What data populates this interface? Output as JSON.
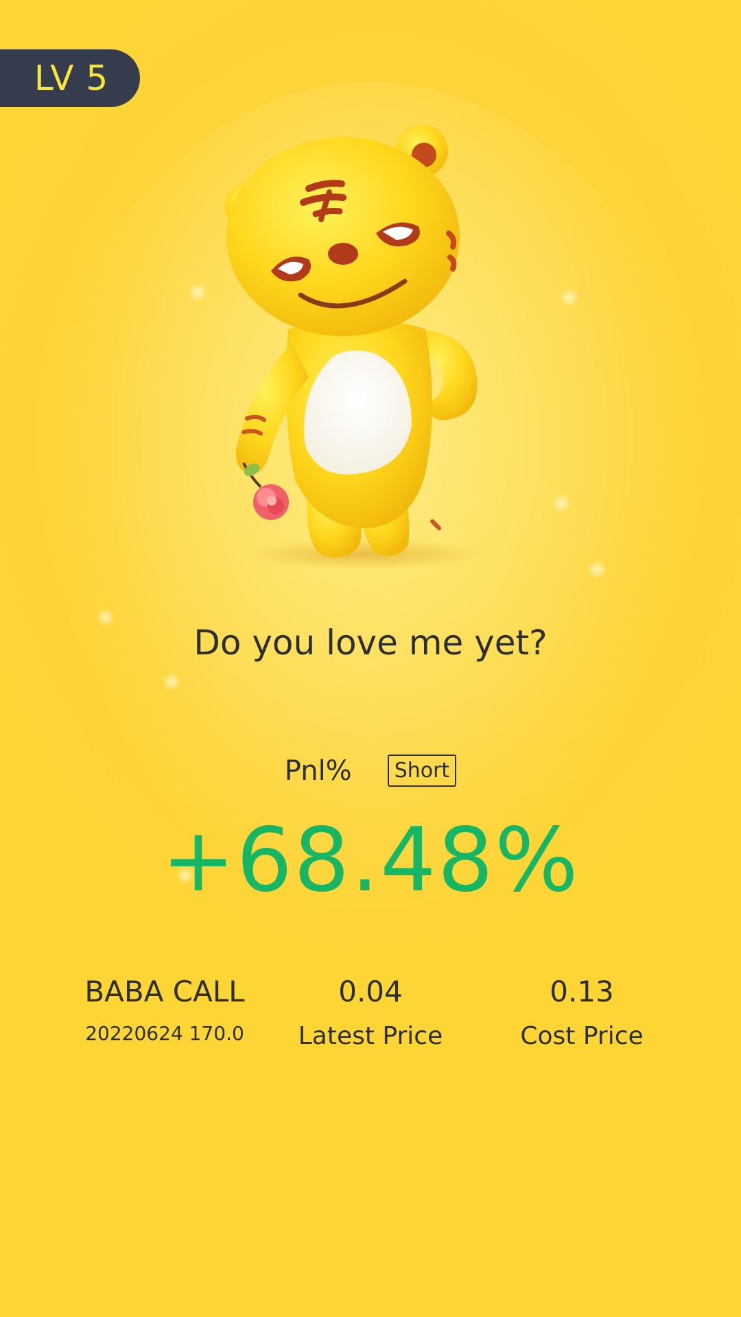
{
  "level_badge": {
    "label": "LV 5"
  },
  "mascot": {
    "icon": "tiger-mascot-icon",
    "holding": "flower-icon"
  },
  "tagline": "Do you love me yet?",
  "pnl": {
    "label": "Pnl%",
    "direction_tag": "Short",
    "value": "+68.48%",
    "value_color": "#16B665"
  },
  "stats": {
    "contract": {
      "symbol": "BABA CALL",
      "detail": "20220624 170.0"
    },
    "latest": {
      "value": "0.04",
      "label": "Latest Price"
    },
    "cost": {
      "value": "0.13",
      "label": "Cost Price"
    }
  },
  "colors": {
    "background": "#FDD535",
    "badge_bg": "#353C4E",
    "badge_text": "#F8E63A",
    "text": "#2E2E2E"
  }
}
